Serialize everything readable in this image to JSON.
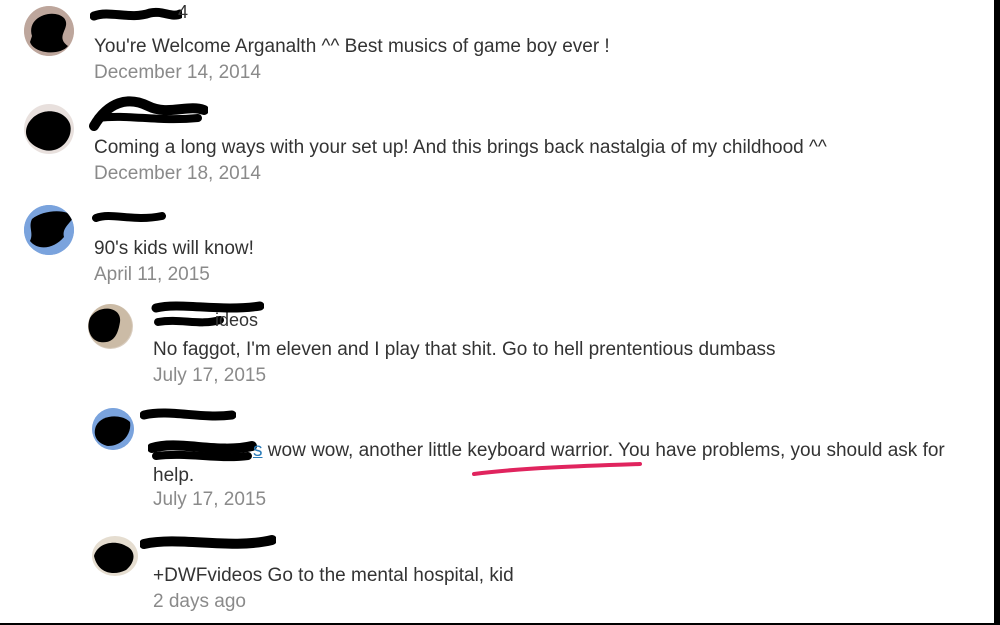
{
  "comments": [
    {
      "name_visible": "4",
      "text": "You're Welcome Arganalth ^^ Best musics of game boy ever !",
      "date": "December 14, 2014"
    },
    {
      "name_visible": "",
      "text": "Coming a long ways with your set up!  And this brings back nastalgia of my childhood ^^",
      "date": "December 18, 2014"
    },
    {
      "name_visible": "",
      "text": "90's kids will know!",
      "date": "April 11, 2015"
    }
  ],
  "replies": [
    {
      "name_visible": "ideos",
      "text": "No faggot, I'm eleven and I play that shit. Go to hell prententious dumbass",
      "date": "July 17, 2015"
    },
    {
      "name_visible": "",
      "mention_visible": "s",
      "text": " wow wow, another little keyboard warrior. You have problems, you should ask for help.",
      "date": "July 17, 2015"
    },
    {
      "name_visible": "",
      "text": "+DWFvideos Go to the mental hospital, kid",
      "date": "2 days ago"
    }
  ],
  "colors": {
    "text": "#333333",
    "date": "#8a8a8a",
    "mention": "#2a7bb8",
    "highlight_underline": "#e0245e",
    "redaction": "#000000"
  }
}
